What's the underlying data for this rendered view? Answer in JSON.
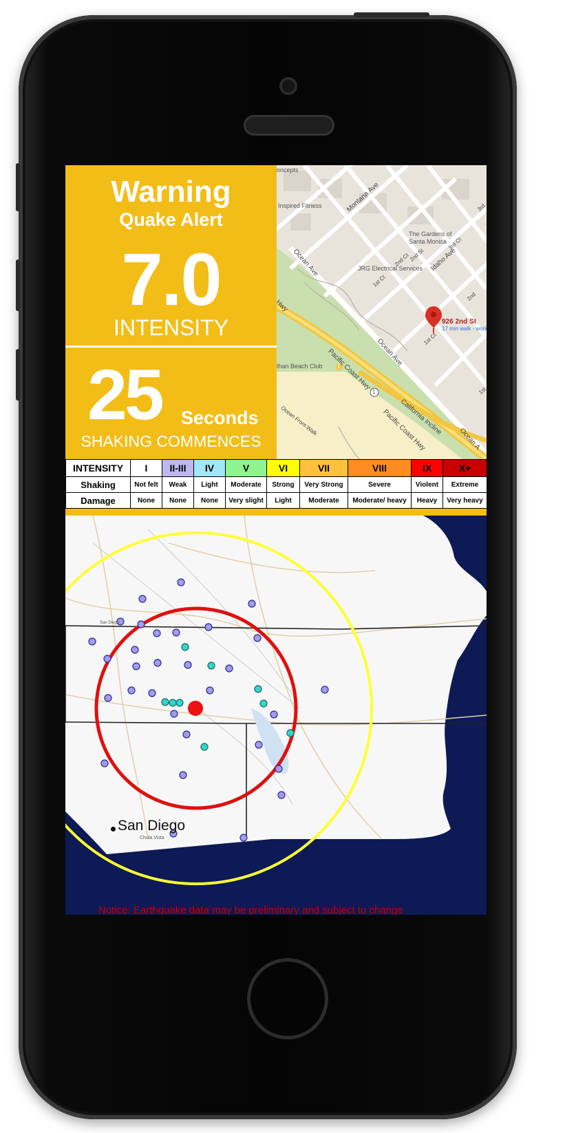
{
  "alert": {
    "warning": "Warning",
    "subtitle": "Quake Alert",
    "magnitude": "7.0",
    "magnitude_label": "INTENSITY",
    "seconds": "25",
    "seconds_label": "Seconds",
    "shaking_label": "SHAKING COMMENCES"
  },
  "street_map": {
    "pin_label": "926 2nd St",
    "pin_sub": "17 min walk - work",
    "labels": {
      "concepts": "oncepts",
      "fitness": "Inspired Fitness",
      "gardens": "The Gardens of",
      "gardens2": "Santa Monica",
      "jrg": "JRG Electrical Services",
      "beachclub": "than Beach Club",
      "frontwalk": "Ocean Front Walk",
      "montana": "Montana Ave",
      "idaho": "Idaho Ave",
      "ocean1": "Ocean Ave",
      "ocean2": "Ocean Ave",
      "ocean3": "Ocean A",
      "pch1": "Pacific Coast Hwy",
      "pch2": "Pacific Coast Hwy",
      "incline": "California Incline",
      "firstct1": "1st Ct",
      "firstct2": "1st Ct",
      "firstct3": "1st",
      "secondct": "2nd Ct",
      "second": "2nd",
      "secondst": "2nd St",
      "thirdct": "3rd Ct",
      "third": "3rd",
      "hwy": "t Hwy",
      "r1": "1",
      "r2": "1"
    }
  },
  "intensity_scale": {
    "row_headers": [
      "INTENSITY",
      "Shaking",
      "Damage"
    ],
    "levels": [
      {
        "level": "I",
        "shaking": "Not felt",
        "damage": "None",
        "color": "#ffffff"
      },
      {
        "level": "II-III",
        "shaking": "Weak",
        "damage": "None",
        "color": "#bfb8f0"
      },
      {
        "level": "IV",
        "shaking": "Light",
        "damage": "None",
        "color": "#9fe8f8"
      },
      {
        "level": "V",
        "shaking": "Moderate",
        "damage": "Very slight",
        "color": "#8ef58e"
      },
      {
        "level": "VI",
        "shaking": "Strong",
        "damage": "Light",
        "color": "#ffff00"
      },
      {
        "level": "VII",
        "shaking": "Very Strong",
        "damage": "Moderate",
        "color": "#ffc040"
      },
      {
        "level": "VIII",
        "shaking": "Severe",
        "damage": "Moderate/ heavy",
        "color": "#ff8c22"
      },
      {
        "level": "IX",
        "shaking": "Violent",
        "damage": "Heavy",
        "color": "#ff0000"
      },
      {
        "level": "X+",
        "shaking": "Extreme",
        "damage": "Very heavy",
        "color": "#c80000"
      }
    ]
  },
  "region_map": {
    "city": "San Diego",
    "city_small": "Chula Vista",
    "small_label": "San Diego",
    "notice": "Notice: Earthquake data may be preliminary and subject to change",
    "ocean_color": "#0e1a55",
    "outer_ring_color": "#ffff33",
    "inner_ring_color": "#e01010",
    "epicenter_color": "#ee1111"
  }
}
